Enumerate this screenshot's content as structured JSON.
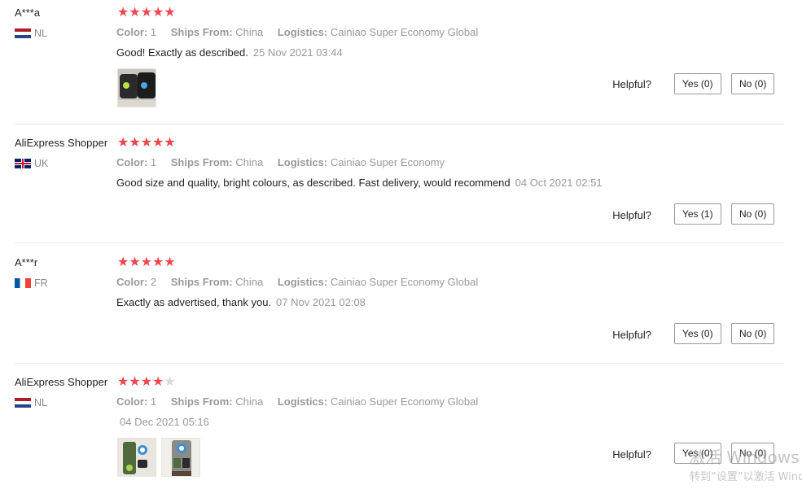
{
  "reviews": [
    {
      "user": "A***a",
      "country": "NL",
      "rating": 5,
      "color_label": "Color:",
      "color": "1",
      "ships_label": "Ships From:",
      "ships": "China",
      "logistics_label": "Logistics:",
      "logistics": "Cainiao Super Economy Global",
      "text": "Good! Exactly as described.",
      "date": "25 Nov 2021 03:44",
      "helpful_label": "Helpful?",
      "yes": "Yes (0)",
      "no": "No (0)"
    },
    {
      "user": "AliExpress Shopper",
      "country": "UK",
      "rating": 5,
      "color_label": "Color:",
      "color": "1",
      "ships_label": "Ships From:",
      "ships": "China",
      "logistics_label": "Logistics:",
      "logistics": "Cainiao Super Economy",
      "text": "Good size and quality, bright colours, as described. Fast delivery, would recommend",
      "date": "04 Oct 2021 02:51",
      "helpful_label": "Helpful?",
      "yes": "Yes (1)",
      "no": "No (0)"
    },
    {
      "user": "A***r",
      "country": "FR",
      "rating": 5,
      "color_label": "Color:",
      "color": "2",
      "ships_label": "Ships From:",
      "ships": "China",
      "logistics_label": "Logistics:",
      "logistics": "Cainiao Super Economy Global",
      "text": "Exactly as advertised, thank you.",
      "date": "07 Nov 2021 02:08",
      "helpful_label": "Helpful?",
      "yes": "Yes (0)",
      "no": "No (0)"
    },
    {
      "user": "AliExpress Shopper",
      "country": "NL",
      "rating": 4,
      "color_label": "Color:",
      "color": "1",
      "ships_label": "Ships From:",
      "ships": "China",
      "logistics_label": "Logistics:",
      "logistics": "Cainiao Super Economy Global",
      "text": "",
      "date": "04 Dec 2021 05:16",
      "helpful_label": "Helpful?",
      "yes": "Yes (0)",
      "no": "No (0)"
    }
  ],
  "watermark": {
    "line1": "激活 Windows",
    "line2": "转到“设置”以激活 Windows。"
  },
  "colors": {
    "star": "#f0464e",
    "star_off": "#d9d9d9"
  }
}
